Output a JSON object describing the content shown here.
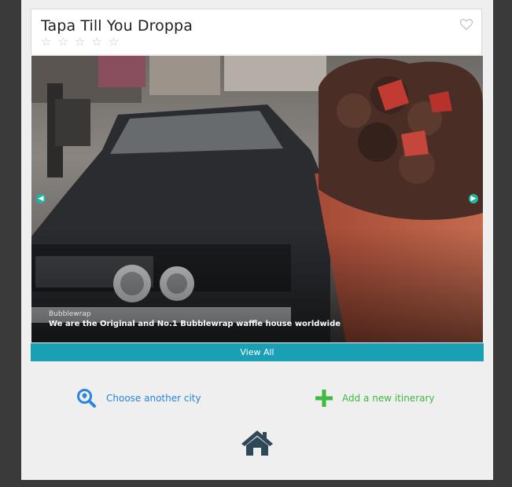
{
  "card": {
    "title": "Tapa Till You Droppa",
    "rating_stars": 5,
    "rating_value": 0,
    "favorite_icon": "heart-outline-icon"
  },
  "carousel": {
    "slide_subtitle": "Bubblewrap",
    "slide_title": "We are the Original and No.1 Bubblewrap waffle house worldwide",
    "prev_icon": "arrow-left-icon",
    "next_icon": "arrow-right-icon"
  },
  "view_all_label": "View All",
  "actions": {
    "choose_city_label": "Choose another city",
    "add_itinerary_label": "Add a new itinerary"
  },
  "colors": {
    "accent_teal": "#1aa0b5",
    "link_blue": "#2b84dd",
    "add_green": "#3fb93f",
    "home_icon": "#2f4858"
  }
}
